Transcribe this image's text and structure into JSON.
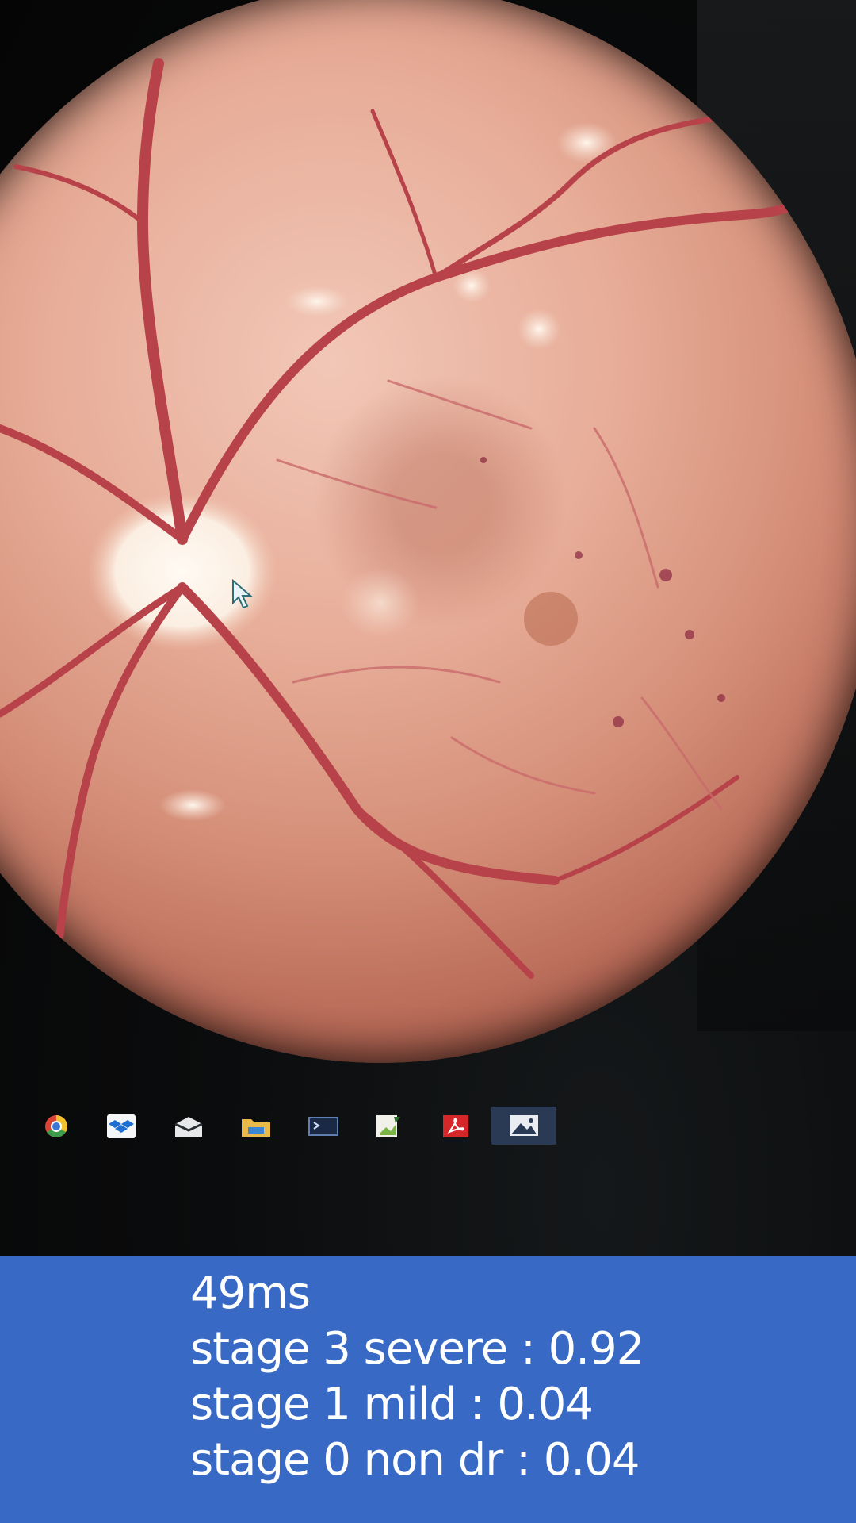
{
  "camera": {
    "subject": "fundus-photo",
    "taskbar_icons": [
      {
        "name": "chrome-icon"
      },
      {
        "name": "dropbox-icon"
      },
      {
        "name": "mail-icon"
      },
      {
        "name": "folder-icon"
      },
      {
        "name": "terminal-icon"
      },
      {
        "name": "document-icon"
      },
      {
        "name": "acrobat-icon"
      },
      {
        "name": "photos-icon",
        "active": true
      }
    ]
  },
  "result": {
    "latency": "49ms",
    "predictions": [
      {
        "text": "stage 3 severe : 0.92"
      },
      {
        "text": "stage 1 mild : 0.04"
      },
      {
        "text": "stage 0 non dr : 0.04"
      }
    ]
  },
  "colors": {
    "panel_background": "#386ac5",
    "panel_text": "#ffffff",
    "retina_base": "#e7ad98",
    "vessel": "#b8424a"
  }
}
